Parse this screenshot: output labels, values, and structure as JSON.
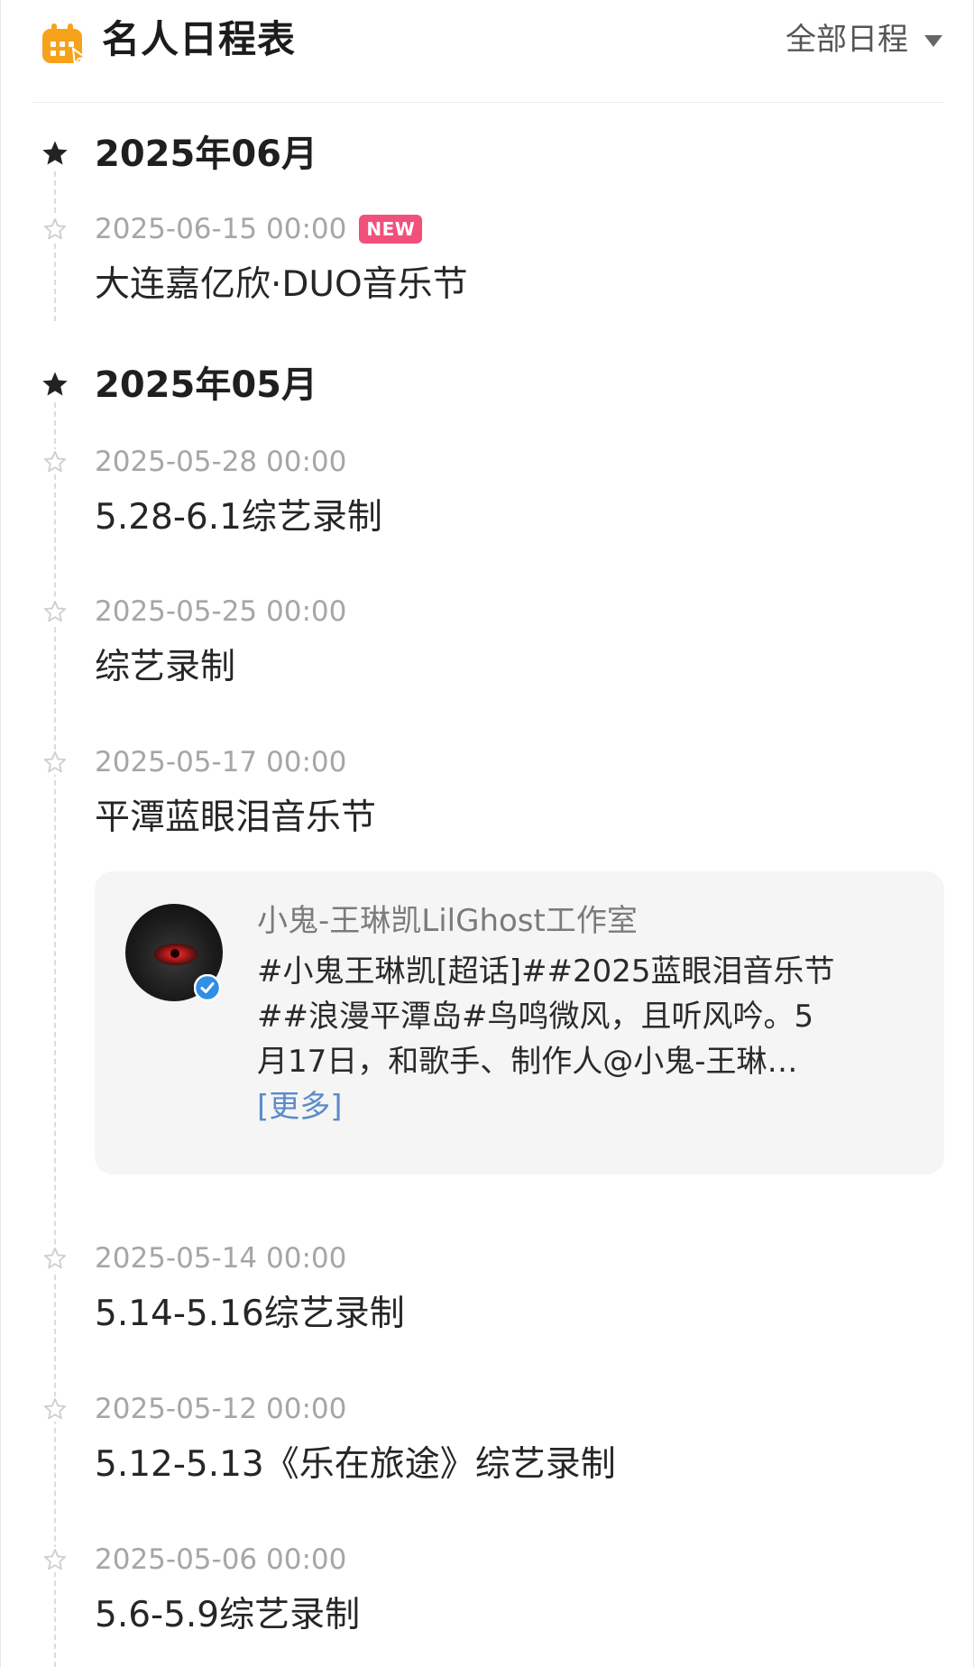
{
  "header": {
    "title": "名人日程表",
    "logo_icon": "calendar-icon",
    "logo_color": "#f7a21b",
    "filter_label": "全部日程",
    "filter_icon": "triangle-down-icon"
  },
  "months": [
    {
      "label": "2025年06月",
      "events": [
        {
          "time": "2025-06-15 00:00",
          "badge": "NEW",
          "title": "大连嘉亿欣·DUO音乐节"
        }
      ]
    },
    {
      "label": "2025年05月",
      "events": [
        {
          "time": "2025-05-28 00:00",
          "title": "5.28-6.1综艺录制"
        },
        {
          "time": "2025-05-25 00:00",
          "title": "综艺录制"
        },
        {
          "time": "2025-05-17 00:00",
          "title": "平潭蓝眼泪音乐节"
        },
        {
          "time": "2025-05-14 00:00",
          "title": "5.14-5.16综艺录制"
        },
        {
          "time": "2025-05-12 00:00",
          "title": "5.12-5.13《乐在旅途》综艺录制"
        },
        {
          "time": "2025-05-06 00:00",
          "title": "5.6-5.9综艺录制"
        }
      ]
    }
  ],
  "post": {
    "author": "小鬼-王琳凯LilGhost工作室",
    "verified_icon": "verified-check-icon",
    "text_lines": [
      "#小鬼王琳凯[超话]##2025蓝眼泪音乐节",
      "##浪漫平潭岛#鸟鸣微风，且听风吟。5",
      "月17日，和歌手、制作人@小鬼-王琳…"
    ],
    "more_label": "[更多]"
  },
  "colors": {
    "badge_new": "#f0507a",
    "link": "#5b8bc9",
    "verified": "#2f8ee5"
  }
}
